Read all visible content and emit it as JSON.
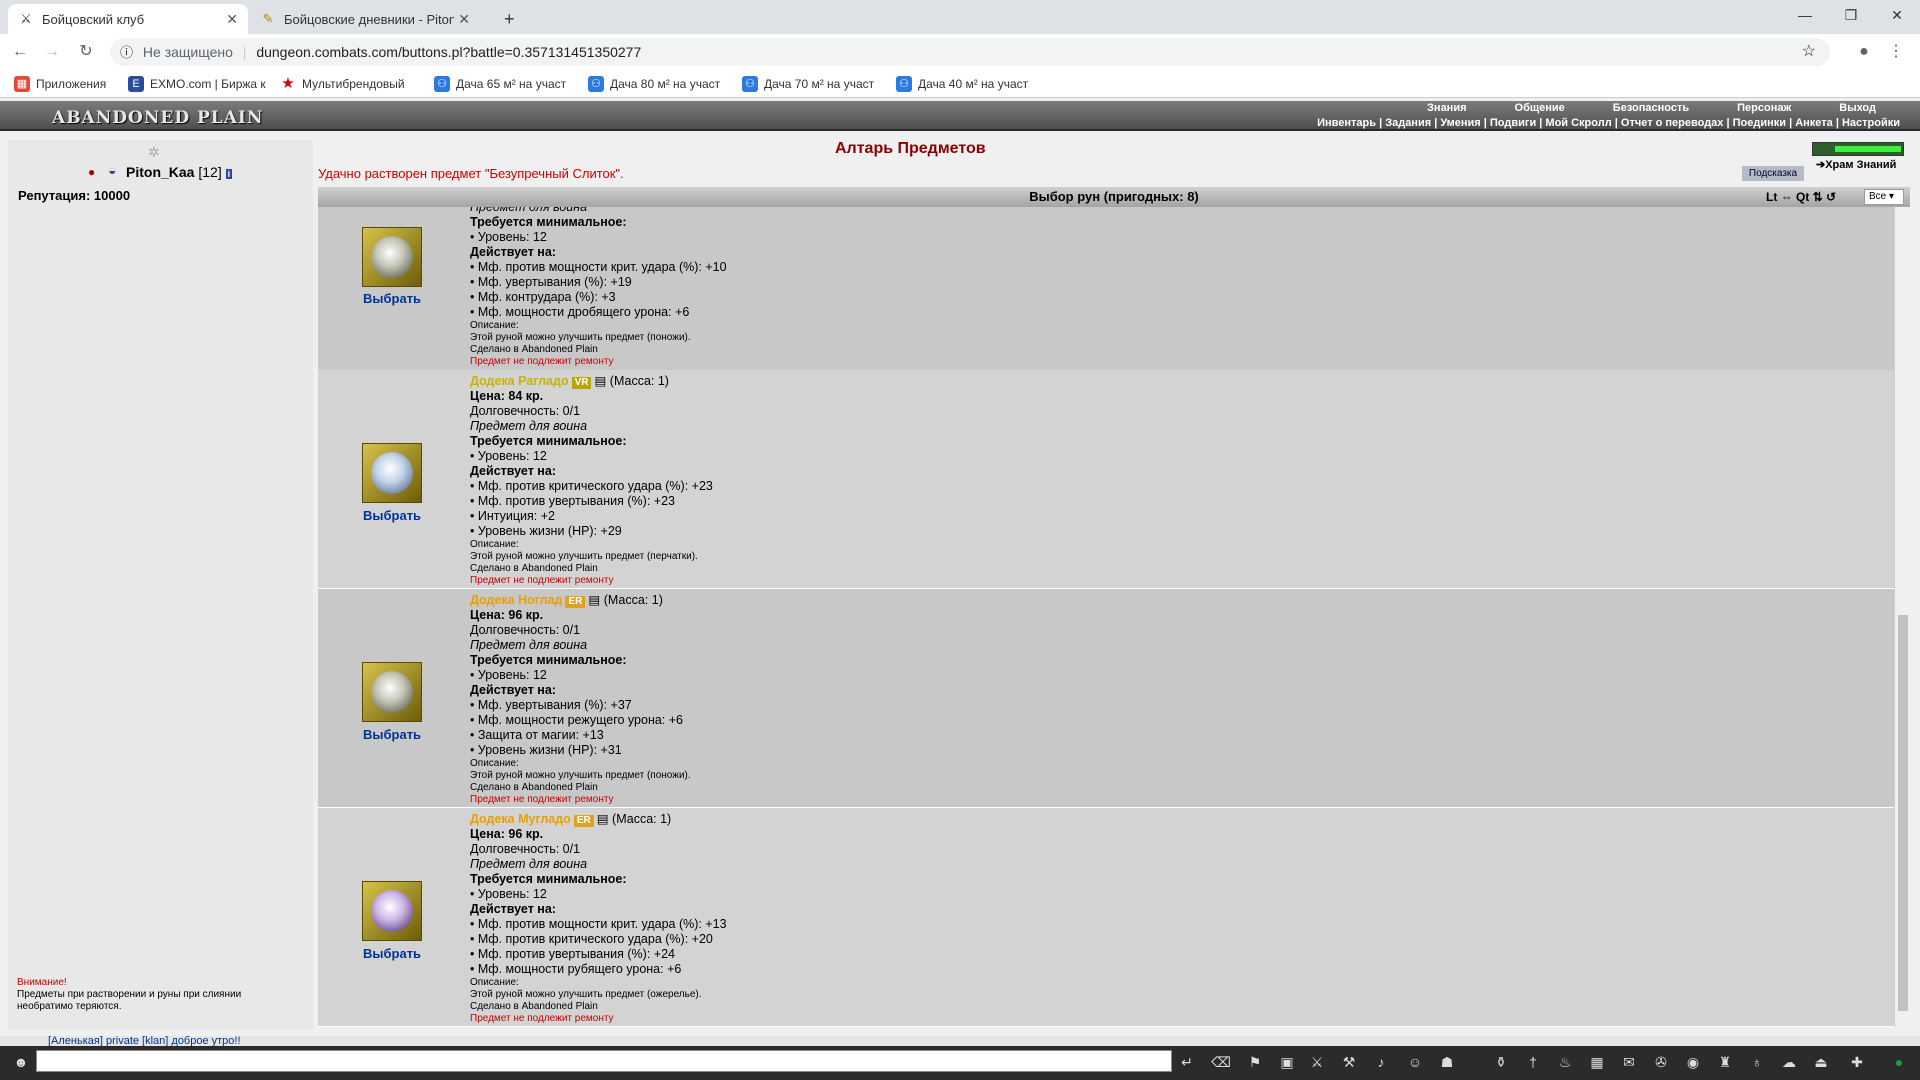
{
  "browser": {
    "tabs": [
      {
        "title": "Бойцовский клуб",
        "icon": "swords-icon"
      },
      {
        "title": "Бойцовские дневники - Piton_K",
        "icon": "feather-icon"
      }
    ],
    "new_tab": "+",
    "address_security": "Не защищено",
    "url": "dungeon.combats.com/buttons.pl?battle=0.357131451350277",
    "bookmarks": [
      {
        "label": "Приложения",
        "color": "#e04a3a"
      },
      {
        "label": "EXMO.com | Биржа к",
        "color": "#2b4c9a"
      },
      {
        "label": "Мультибрендовый",
        "color": "#d00"
      },
      {
        "label": "Дача 65 м² на участ",
        "color": "#2a7ae2"
      },
      {
        "label": "Дача 80 м² на участ",
        "color": "#2a7ae2"
      },
      {
        "label": "Дача 70 м² на участ",
        "color": "#2a7ae2"
      },
      {
        "label": "Дача 40 м² на участ",
        "color": "#2a7ae2"
      }
    ]
  },
  "game": {
    "logo": "ABANDONED PLAIN",
    "menu_top": [
      "Знания",
      "Общение",
      "Безопасность",
      "Персонаж",
      "Выход"
    ],
    "menu_sub": "Инвентарь | Задания | Умения | Подвиги | Мой Скролл | Отчет о переводах | Поединки | Анкета | Настройки",
    "player": {
      "name": "Piton_Kaa",
      "level": "[12]"
    },
    "reputation": "Репутация: 10000",
    "warning_title": "Внимание!",
    "warning_text": "Предметы при растворении и руны при слиянии необратимо теряются.",
    "page_title": "Алтарь Предметов",
    "message": "Удачно растворен предмет \"Безупречный Слиток\".",
    "hint_button": "Подсказка",
    "temple_link": "Храм Знаний",
    "list_header": "Выбор рун (пригодных: 8)",
    "list_tools": "Lt ⇔ Qt ⇅ ↺",
    "filter_value": "Все",
    "choose_label": "Выбрать",
    "items": [
      {
        "name": "",
        "tag": "",
        "mass": "",
        "price": "",
        "durability": "",
        "kind": "Предмет для воина",
        "req_title": "Требуется минимальное:",
        "req": "• Уровень: 12",
        "eff_title": "Действует на:",
        "effects": [
          "• Мф. против мощности крит. удара (%): +10",
          "• Мф. увертывания (%): +19",
          "• Мф. контрудара (%): +3",
          "• Мф. мощности дробящего урона: +6"
        ],
        "desc_title": "Описание:",
        "desc": "Этой руной можно улучшить предмет (поножи).",
        "made": "Сделано в Abandoned Plain",
        "repair": "Предмет не подлежит ремонту"
      },
      {
        "name": "Додека Рагладо",
        "tag": "VR",
        "mass": "(Масса: 1)",
        "price": "Цена: 84 кр.",
        "durability": "Долговечность: 0/1",
        "kind": "Предмет для воина",
        "req_title": "Требуется минимальное:",
        "req": "• Уровень: 12",
        "eff_title": "Действует на:",
        "effects": [
          "• Мф. против критического удара (%): +23",
          "• Мф. против увертывания (%): +23",
          "• Интуиция: +2",
          "• Уровень жизни (HP): +29"
        ],
        "desc_title": "Описание:",
        "desc": "Этой руной можно улучшить предмет (перчатки).",
        "made": "Сделано в Abandoned Plain",
        "repair": "Предмет не подлежит ремонту"
      },
      {
        "name": "Додека Ноглад",
        "tag": "ER",
        "mass": "(Масса: 1)",
        "price": "Цена: 96 кр.",
        "durability": "Долговечность: 0/1",
        "kind": "Предмет для воина",
        "req_title": "Требуется минимальное:",
        "req": "• Уровень: 12",
        "eff_title": "Действует на:",
        "effects": [
          "• Мф. увертывания (%): +37",
          "• Мф. мощности режущего урона: +6",
          "• Защита от магии: +13",
          "• Уровень жизни (HP): +31"
        ],
        "desc_title": "Описание:",
        "desc": "Этой руной можно улучшить предмет (поножи).",
        "made": "Сделано в Abandoned Plain",
        "repair": "Предмет не подлежит ремонту"
      },
      {
        "name": "Додека Мугладо",
        "tag": "ER",
        "mass": "(Масса: 1)",
        "price": "Цена: 96 кр.",
        "durability": "Долговечность: 0/1",
        "kind": "Предмет для воина",
        "req_title": "Требуется минимальное:",
        "req": "• Уровень: 12",
        "eff_title": "Действует на:",
        "effects": [
          "• Мф. против мощности крит. удара (%): +13",
          "• Мф. против критического удара (%): +20",
          "• Мф. против увертывания (%): +24",
          "• Мф. мощности рубящего урона: +6"
        ],
        "desc_title": "Описание:",
        "desc": "Этой руной можно улучшить предмет (ожерелье).",
        "made": "Сделано в Abandoned Plain",
        "repair": "Предмет не подлежит ремонту"
      }
    ],
    "chat_line": "[Аленькая] private [klan] доброе утро!!"
  }
}
